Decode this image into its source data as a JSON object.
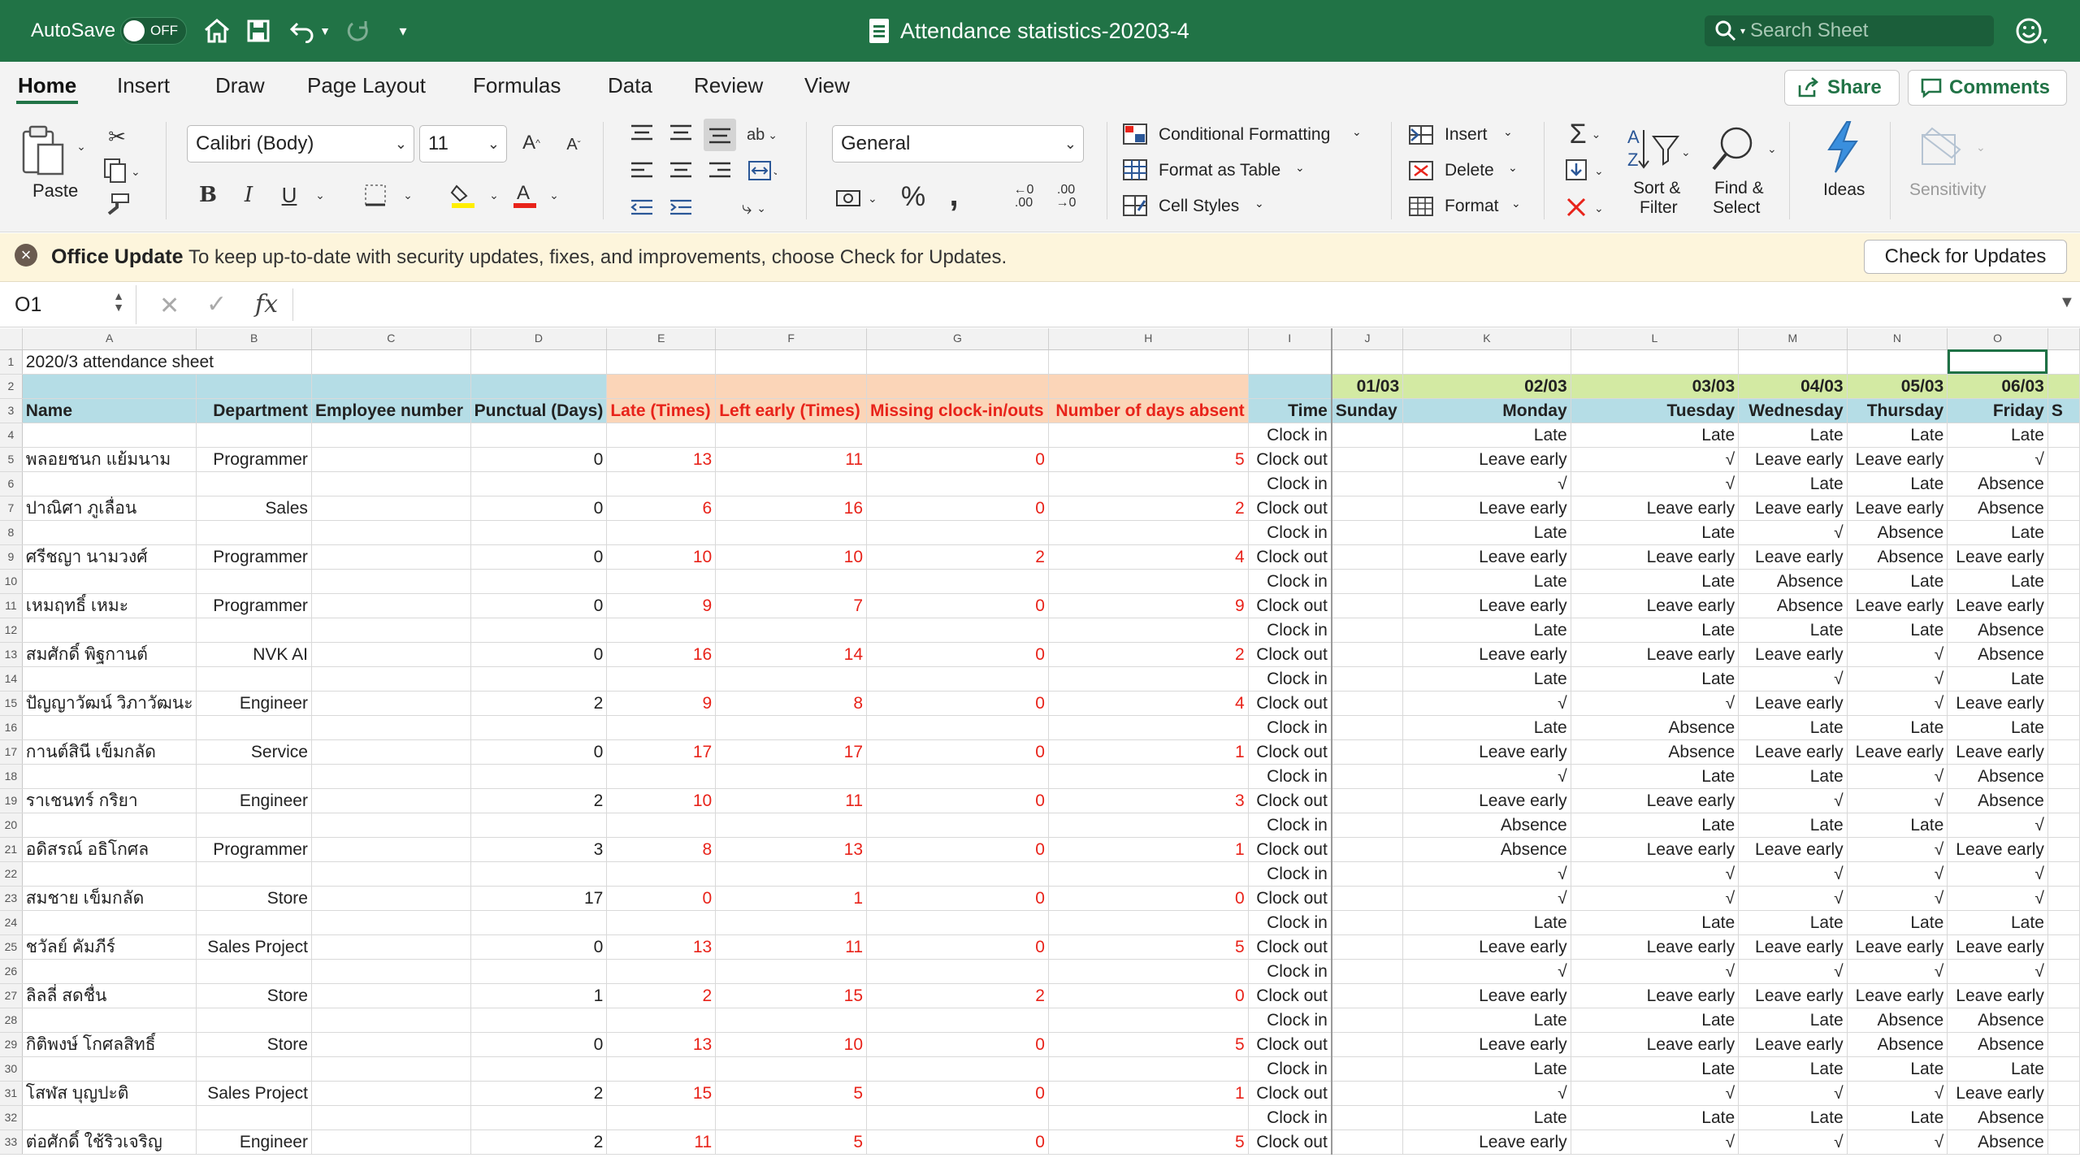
{
  "titlebar": {
    "autosave": "AutoSave",
    "toggle": "OFF",
    "doc_title": "Attendance statistics-20203-4",
    "search_placeholder": "Search Sheet"
  },
  "tabs": [
    "Home",
    "Insert",
    "Draw",
    "Page Layout",
    "Formulas",
    "Data",
    "Review",
    "View"
  ],
  "share": "Share",
  "comments": "Comments",
  "ribbon": {
    "paste": "Paste",
    "font": "Calibri (Body)",
    "size": "11",
    "number_format": "General",
    "cond_format": "Conditional Formatting",
    "format_table": "Format as Table",
    "cell_styles": "Cell Styles",
    "insert": "Insert",
    "delete": "Delete",
    "format": "Format",
    "sort_filter": [
      "Sort &",
      "Filter"
    ],
    "find_select": [
      "Find &",
      "Select"
    ],
    "ideas": "Ideas",
    "sensitivity": "Sensitivity",
    "bold": "B",
    "italic": "I",
    "underline": "U",
    "percent": "%",
    "comma": ",",
    "inc_decimal": ".00",
    "dec_decimal": ".00"
  },
  "update": {
    "title": "Office Update",
    "message": "To keep up-to-date with security updates, fixes, and improvements, choose Check for Updates.",
    "button": "Check for Updates"
  },
  "formula": {
    "namebox": "O1",
    "fx": "fx",
    "value": ""
  },
  "sheet": {
    "col_letters": [
      "A",
      "B",
      "C",
      "D",
      "E",
      "F",
      "G",
      "H",
      "I",
      "J",
      "K",
      "L",
      "M",
      "N",
      "O"
    ],
    "row1": "2020/3 attendance sheet",
    "dates": [
      "01/03",
      "02/03",
      "03/03",
      "04/03",
      "05/03",
      "06/03"
    ],
    "weekdays": [
      "Sunday",
      "Monday",
      "Tuesday",
      "Wednesday",
      "Thursday",
      "Friday"
    ],
    "weekday_partial": "S",
    "headers": [
      "Name",
      "Department",
      "Employee number",
      "Punctual (Days)",
      "Late (Times)",
      "Left early (Times)",
      "Missing clock-in/outs",
      "Number of days absent",
      "Time"
    ],
    "clock_in": "Clock in",
    "clock_out": "Clock out",
    "employees": [
      {
        "name": "พลอยชนก แย้มนาม",
        "dept": "Programmer",
        "punctual": "0",
        "late": "13",
        "early": "11",
        "missing": "0",
        "absent": "5",
        "in": [
          "",
          "Late",
          "Late",
          "Late",
          "Late",
          "Late"
        ],
        "out": [
          "",
          "Leave early",
          "√",
          "Leave early",
          "Leave early",
          "√"
        ]
      },
      {
        "name": "ปาณิศา ภูเลื่อน",
        "dept": "Sales",
        "punctual": "0",
        "late": "6",
        "early": "16",
        "missing": "0",
        "absent": "2",
        "in": [
          "",
          "√",
          "√",
          "Late",
          "Late",
          "Absence"
        ],
        "out": [
          "",
          "Leave early",
          "Leave early",
          "Leave early",
          "Leave early",
          "Absence"
        ]
      },
      {
        "name": "ศรีชญา นามวงศ์",
        "dept": "Programmer",
        "punctual": "0",
        "late": "10",
        "early": "10",
        "missing": "2",
        "absent": "4",
        "in": [
          "",
          "Late",
          "Late",
          "√",
          "Absence",
          "Late"
        ],
        "out": [
          "",
          "Leave early",
          "Leave early",
          "Leave early",
          "Absence",
          "Leave early"
        ]
      },
      {
        "name": "เหมฤทธิ์ เหมะ",
        "dept": "Programmer",
        "punctual": "0",
        "late": "9",
        "early": "7",
        "missing": "0",
        "absent": "9",
        "in": [
          "",
          "Late",
          "Late",
          "Absence",
          "Late",
          "Late"
        ],
        "out": [
          "",
          "Leave early",
          "Leave early",
          "Absence",
          "Leave early",
          "Leave early"
        ]
      },
      {
        "name": "สมศักดิ์ พิฐกานต์",
        "dept": "NVK AI",
        "punctual": "0",
        "late": "16",
        "early": "14",
        "missing": "0",
        "absent": "2",
        "in": [
          "",
          "Late",
          "Late",
          "Late",
          "Late",
          "Absence"
        ],
        "out": [
          "",
          "Leave early",
          "Leave early",
          "Leave early",
          "√",
          "Absence"
        ]
      },
      {
        "name": "ปัญญาวัฒน์ วิภาวัฒนะ",
        "dept": "Engineer",
        "punctual": "2",
        "late": "9",
        "early": "8",
        "missing": "0",
        "absent": "4",
        "in": [
          "",
          "Late",
          "Late",
          "√",
          "√",
          "Late"
        ],
        "out": [
          "",
          "√",
          "√",
          "Leave early",
          "√",
          "Leave early"
        ]
      },
      {
        "name": "กานต์สินี เข็มกลัด",
        "dept": "Service",
        "punctual": "0",
        "late": "17",
        "early": "17",
        "missing": "0",
        "absent": "1",
        "in": [
          "",
          "Late",
          "Absence",
          "Late",
          "Late",
          "Late"
        ],
        "out": [
          "",
          "Leave early",
          "Absence",
          "Leave early",
          "Leave early",
          "Leave early"
        ]
      },
      {
        "name": "ราเชนทร์ กริยา",
        "dept": "Engineer",
        "punctual": "2",
        "late": "10",
        "early": "11",
        "missing": "0",
        "absent": "3",
        "in": [
          "",
          "√",
          "Late",
          "Late",
          "√",
          "Absence"
        ],
        "out": [
          "",
          "Leave early",
          "Leave early",
          "√",
          "√",
          "Absence"
        ]
      },
      {
        "name": "อดิสรณ์ อธิโกศล",
        "dept": "Programmer",
        "punctual": "3",
        "late": "8",
        "early": "13",
        "missing": "0",
        "absent": "1",
        "in": [
          "",
          "Absence",
          "Late",
          "Late",
          "Late",
          "√"
        ],
        "out": [
          "",
          "Absence",
          "Leave early",
          "Leave early",
          "√",
          "Leave early"
        ]
      },
      {
        "name": "สมชาย เข็มกลัด",
        "dept": "Store",
        "punctual": "17",
        "late": "0",
        "early": "1",
        "missing": "0",
        "absent": "0",
        "in": [
          "",
          "√",
          "√",
          "√",
          "√",
          "√"
        ],
        "out": [
          "",
          "√",
          "√",
          "√",
          "√",
          "√"
        ]
      },
      {
        "name": "ชวัลย์ คัมภีร์",
        "dept": "Sales Project",
        "punctual": "0",
        "late": "13",
        "early": "11",
        "missing": "0",
        "absent": "5",
        "in": [
          "",
          "Late",
          "Late",
          "Late",
          "Late",
          "Late"
        ],
        "out": [
          "",
          "Leave early",
          "Leave early",
          "Leave early",
          "Leave early",
          "Leave early"
        ]
      },
      {
        "name": "ลิลลี่ สดชื่น",
        "dept": "Store",
        "punctual": "1",
        "late": "2",
        "early": "15",
        "missing": "2",
        "absent": "0",
        "in": [
          "",
          "√",
          "√",
          "√",
          "√",
          "√"
        ],
        "out": [
          "",
          "Leave early",
          "Leave early",
          "Leave early",
          "Leave early",
          "Leave early"
        ]
      },
      {
        "name": "กิติพงษ์ โกศลสิทธิ์",
        "dept": "Store",
        "punctual": "0",
        "late": "13",
        "early": "10",
        "missing": "0",
        "absent": "5",
        "in": [
          "",
          "Late",
          "Late",
          "Late",
          "Absence",
          "Absence"
        ],
        "out": [
          "",
          "Leave early",
          "Leave early",
          "Leave early",
          "Absence",
          "Absence"
        ]
      },
      {
        "name": "โสฬส บุญปะติ",
        "dept": "Sales Project",
        "punctual": "2",
        "late": "15",
        "early": "5",
        "missing": "0",
        "absent": "1",
        "in": [
          "",
          "Late",
          "Late",
          "Late",
          "Late",
          "Late"
        ],
        "out": [
          "",
          "√",
          "√",
          "√",
          "√",
          "Leave early"
        ]
      },
      {
        "name": "ต่อศักดิ์ ใช้ริวเจริญ",
        "dept": "Engineer",
        "punctual": "2",
        "late": "11",
        "early": "5",
        "missing": "0",
        "absent": "5",
        "in": [
          "",
          "Late",
          "Late",
          "Late",
          "Late",
          "Absence"
        ],
        "out": [
          "",
          "Leave early",
          "√",
          "√",
          "√",
          "Absence"
        ]
      }
    ]
  }
}
